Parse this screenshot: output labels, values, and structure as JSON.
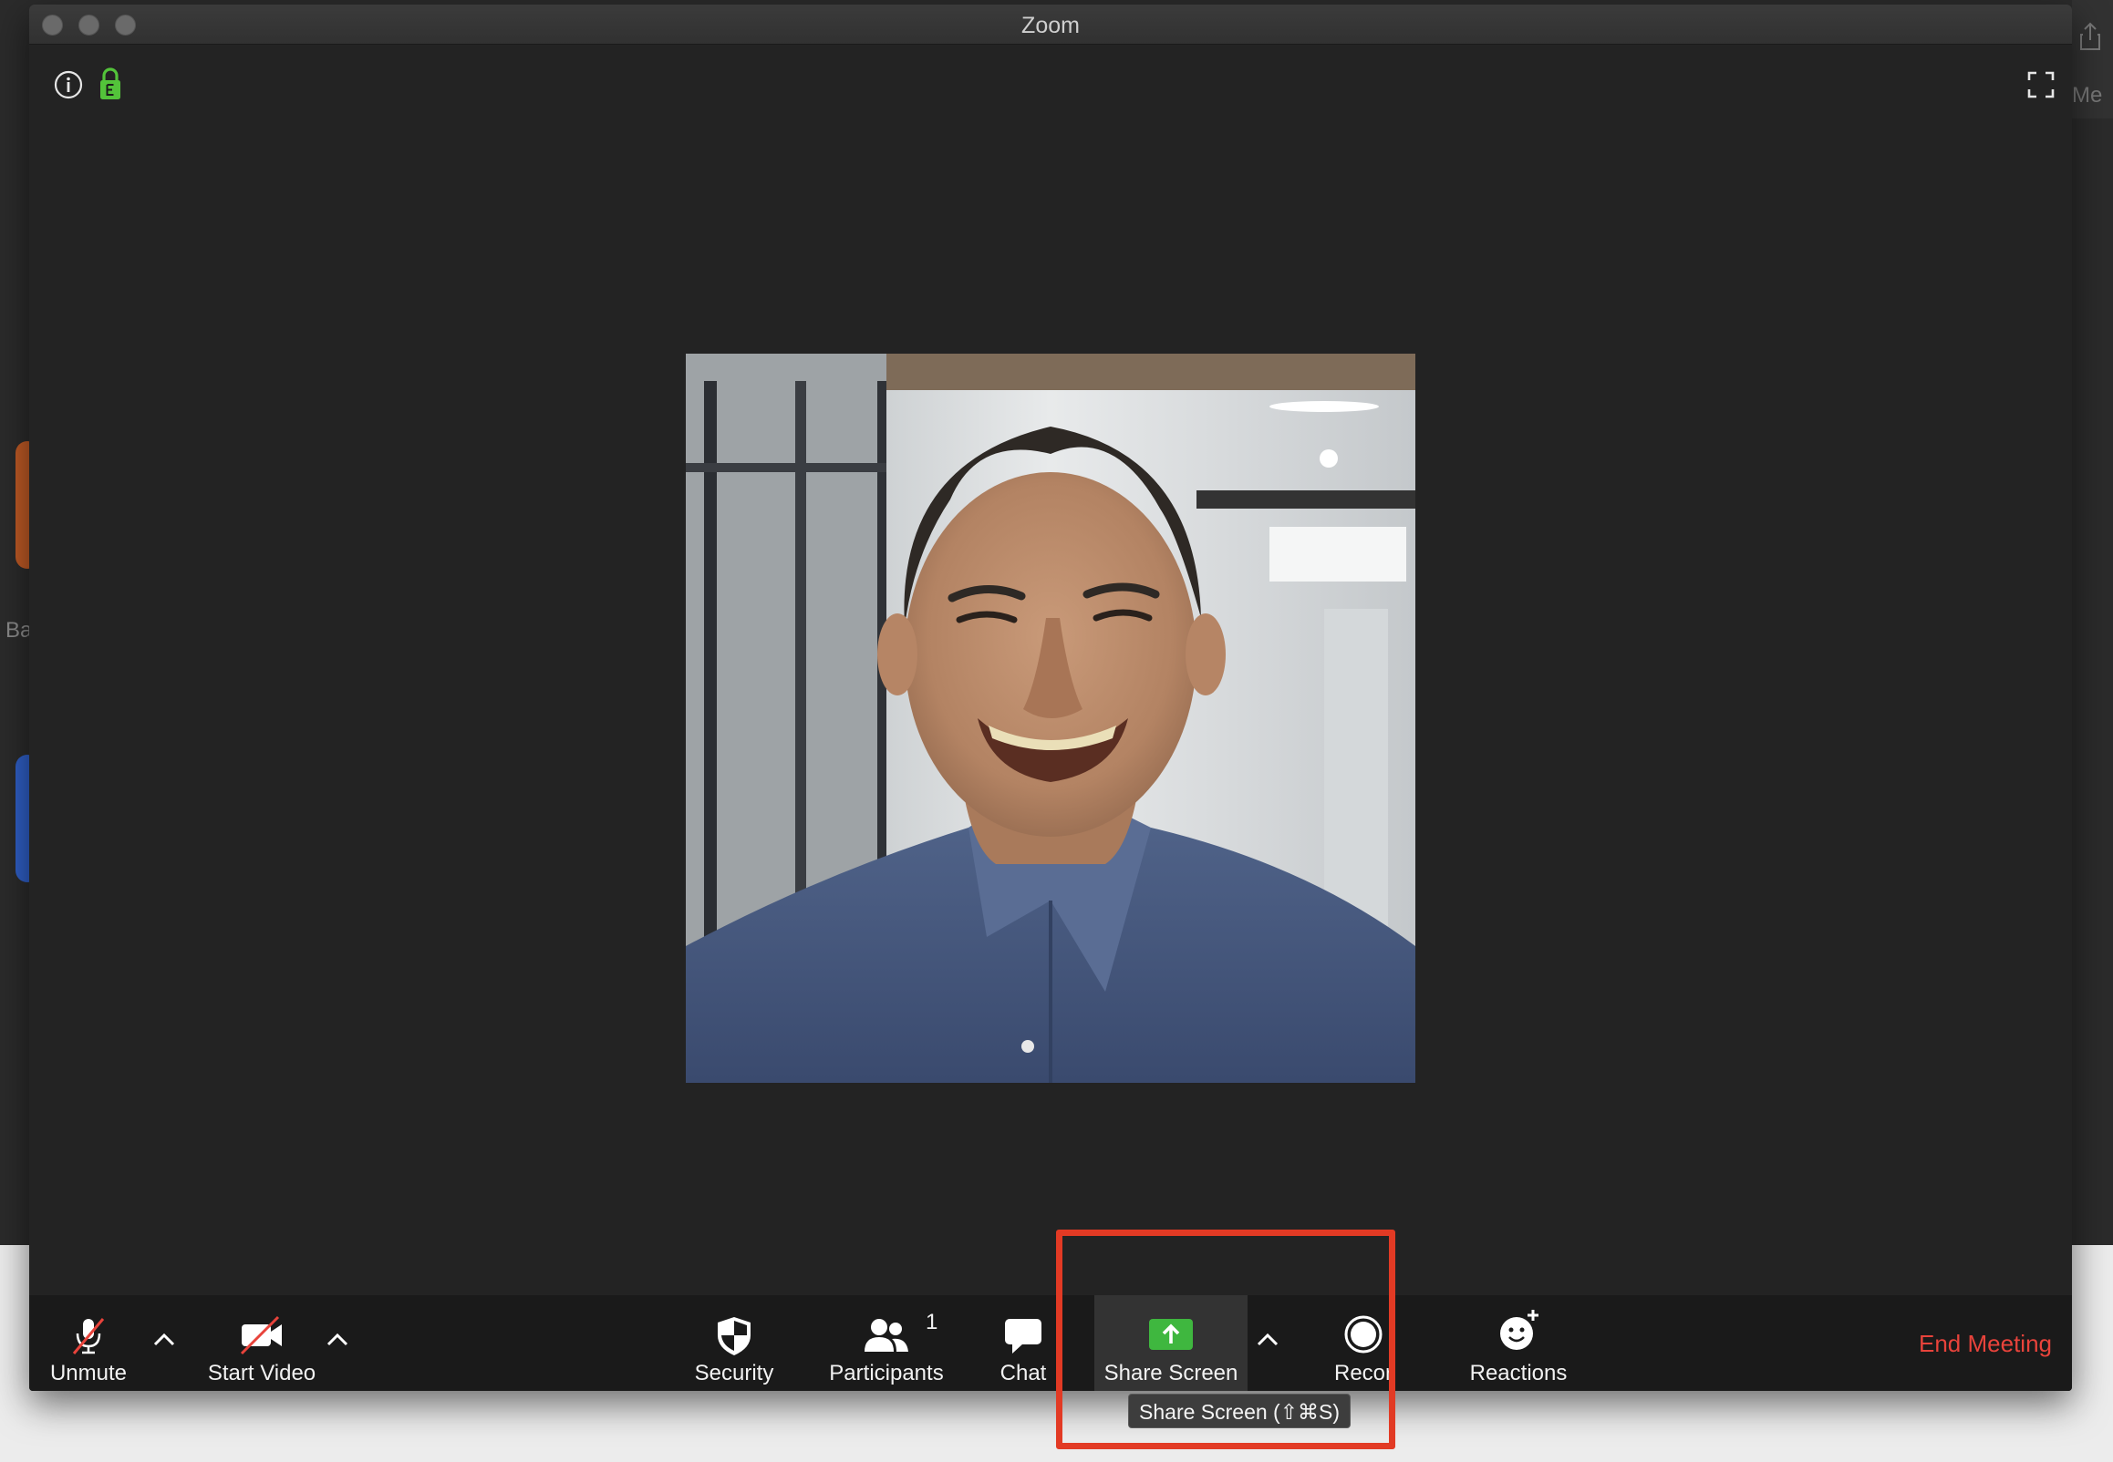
{
  "window": {
    "title": "Zoom"
  },
  "background_app": {
    "left_text": "Ba",
    "right_text": "Me"
  },
  "toolbar": {
    "unmute_label": "Unmute",
    "start_video_label": "Start Video",
    "security_label": "Security",
    "participants_label": "Participants",
    "participants_count": "1",
    "chat_label": "Chat",
    "share_screen_label": "Share Screen",
    "record_label": "Recor",
    "reactions_label": "Reactions",
    "end_meeting_label": "End Meeting"
  },
  "tooltip": {
    "text": "Share Screen (⇧⌘S)"
  },
  "colors": {
    "share_green": "#3fb73f",
    "end_meeting_red": "#e8433b",
    "encryption_green": "#53c33a",
    "annotation_red": "#e23a24",
    "toolbar_bg": "#1a1a1a",
    "window_bg": "#232323"
  },
  "icons": {
    "info": "info-icon",
    "lock": "encryption-lock-icon",
    "fullscreen": "fullscreen-icon",
    "mic": "muted-microphone-icon",
    "video": "video-off-icon",
    "security": "shield-icon",
    "participants": "people-icon",
    "chat": "chat-bubble-icon",
    "share": "share-screen-arrow-icon",
    "record": "record-icon",
    "reactions": "smiley-plus-icon"
  }
}
